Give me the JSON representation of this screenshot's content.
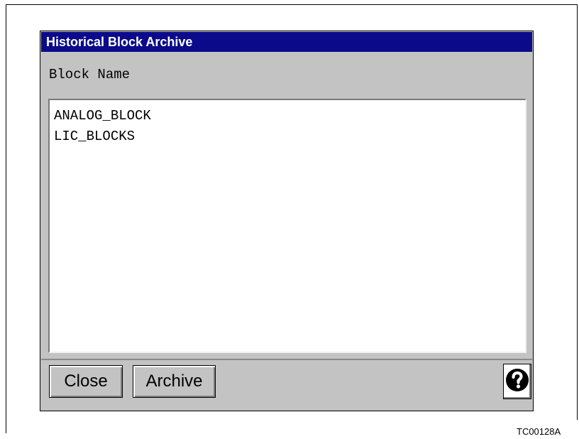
{
  "window": {
    "title": "Historical Block Archive",
    "title_bar_color": "#0a0a8a",
    "background_color": "#c3c3c3"
  },
  "list": {
    "header": "Block Name",
    "items": [
      "ANALOG_BLOCK",
      "LIC_BLOCKS"
    ]
  },
  "buttons": {
    "close_label": "Close",
    "archive_label": "Archive",
    "help_icon": "question-mark-icon"
  },
  "figure_id": "TC00128A"
}
